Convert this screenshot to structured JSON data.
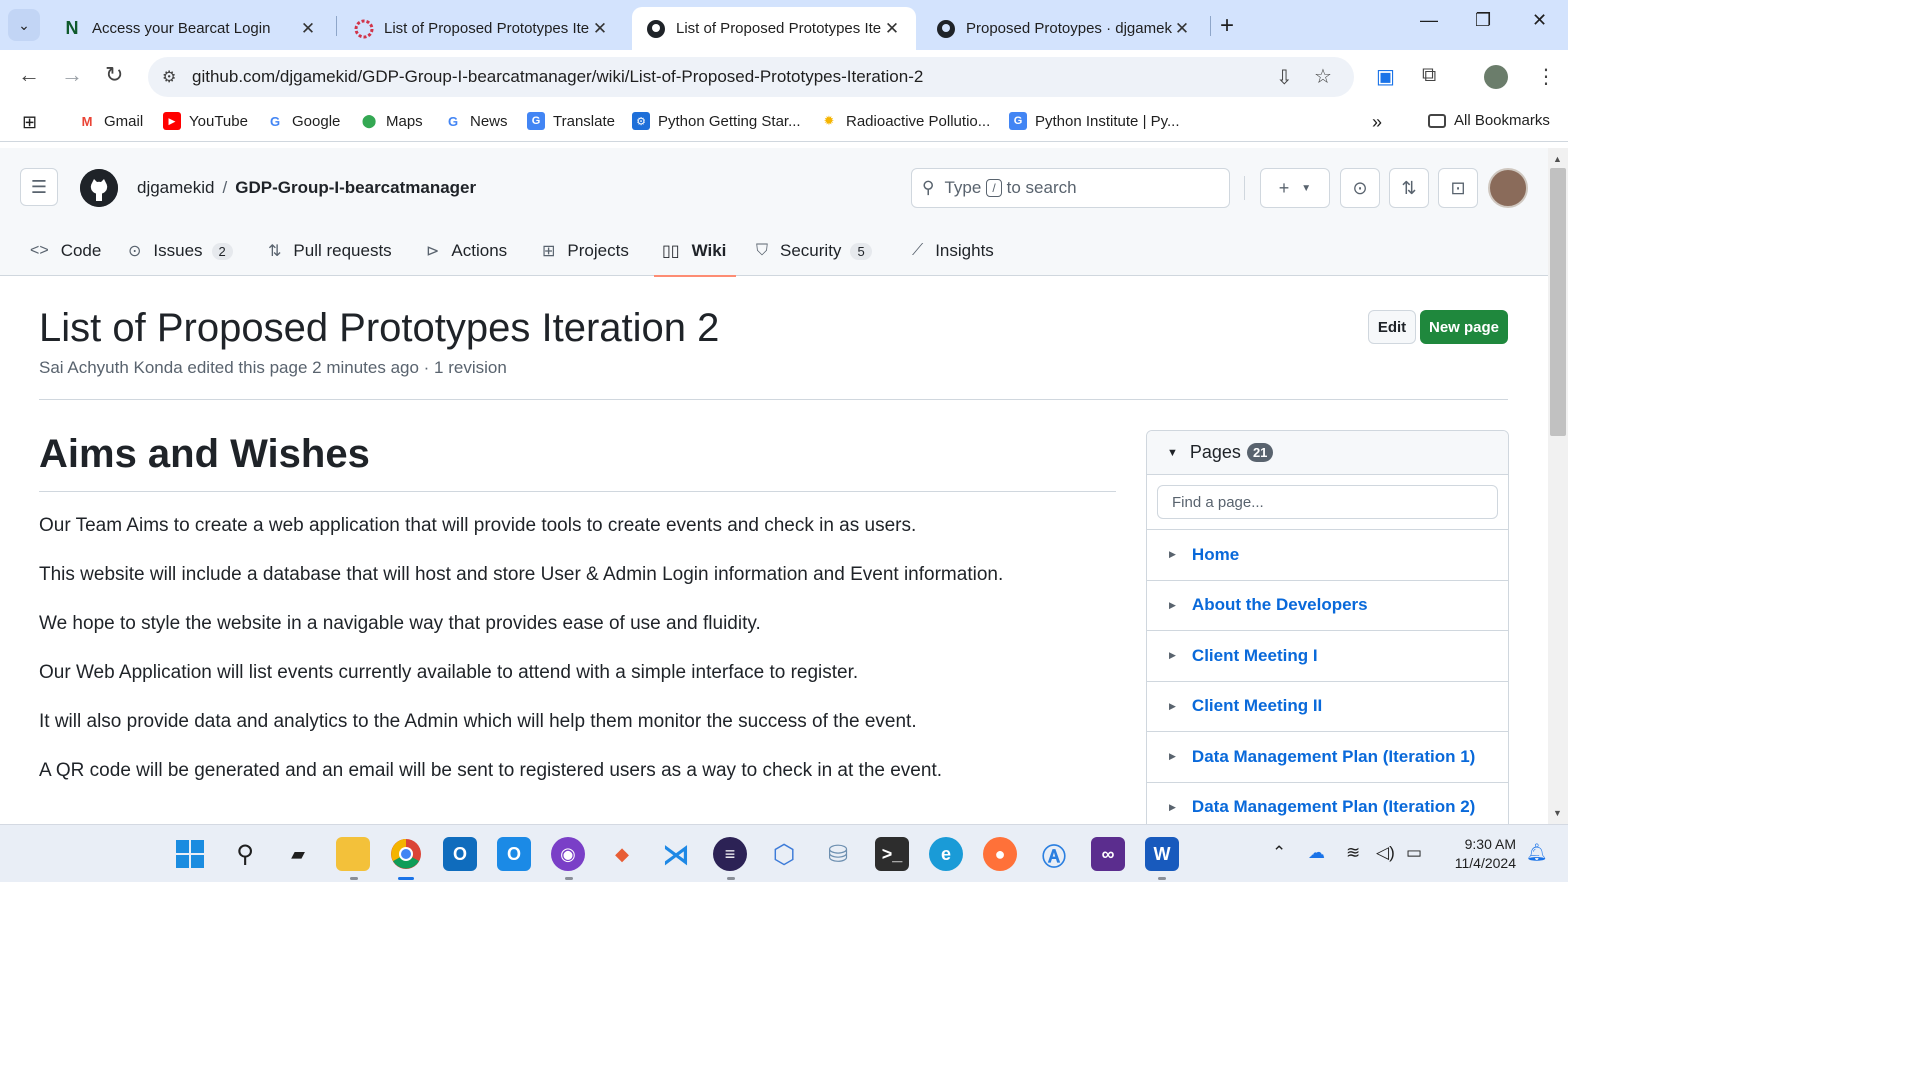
{
  "browser": {
    "tabs": [
      {
        "title": "Access your Bearcat Login",
        "icon": "notion-n-icon",
        "active": false
      },
      {
        "title": "List of Proposed Prototypes Iter",
        "icon": "bearcat-red-icon",
        "active": false
      },
      {
        "title": "List of Proposed Prototypes Iter",
        "icon": "github-icon",
        "active": true
      },
      {
        "title": "Proposed Protoypes · djgameki",
        "icon": "github-icon",
        "active": false
      }
    ],
    "url": "github.com/djgamekid/GDP-Group-I-bearcatmanager/wiki/List-of-Proposed-Prototypes-Iteration-2",
    "bookmarks": [
      {
        "label": "Gmail",
        "icon": "gmail-icon"
      },
      {
        "label": "YouTube",
        "icon": "youtube-icon"
      },
      {
        "label": "Google",
        "icon": "google-icon"
      },
      {
        "label": "Maps",
        "icon": "maps-icon"
      },
      {
        "label": "News",
        "icon": "google-news-icon"
      },
      {
        "label": "Translate",
        "icon": "translate-icon"
      },
      {
        "label": "Python Getting Star...",
        "icon": "pycharm-icon"
      },
      {
        "label": "Radioactive Pollutio...",
        "icon": "sun-icon"
      },
      {
        "label": "Python Institute | Py...",
        "icon": "translate-icon"
      }
    ],
    "all_bookmarks": "All Bookmarks"
  },
  "github": {
    "owner": "djgamekid",
    "repo": "GDP-Group-I-bearcatmanager",
    "search": {
      "prefix": "Type",
      "key": "/",
      "suffix": "to search"
    },
    "nav": [
      {
        "label": "Code",
        "icon": "code-icon",
        "count": ""
      },
      {
        "label": "Issues",
        "icon": "issue-icon",
        "count": "2"
      },
      {
        "label": "Pull requests",
        "icon": "pull-request-icon",
        "count": ""
      },
      {
        "label": "Actions",
        "icon": "play-icon",
        "count": ""
      },
      {
        "label": "Projects",
        "icon": "table-icon",
        "count": ""
      },
      {
        "label": "Wiki",
        "icon": "book-icon",
        "count": ""
      },
      {
        "label": "Security",
        "icon": "shield-icon",
        "count": "5"
      },
      {
        "label": "Insights",
        "icon": "graph-icon",
        "count": ""
      }
    ],
    "selected_nav": "Wiki"
  },
  "wiki": {
    "title": "List of Proposed Prototypes Iteration 2",
    "meta": "Sai Achyuth Konda edited this page 2 minutes ago · 1 revision",
    "edit_label": "Edit",
    "new_page_label": "New page",
    "heading": "Aims and Wishes",
    "paragraphs": [
      "Our Team Aims to create a web application that will provide tools to create events and check in as users.",
      "This website will include a database that will host and store User & Admin Login information and Event information.",
      "We hope to style the website in a navigable way that provides ease of use and fluidity.",
      "Our Web Application will list events currently available to attend with a simple interface to register.",
      "It will also provide data and analytics to the Admin which will help them monitor the success of the event.",
      "A QR code will be generated and an email will be sent to registered users as a way to check in at the event."
    ]
  },
  "sidebar": {
    "title": "Pages",
    "count": "21",
    "find_placeholder": "Find a page...",
    "pages": [
      "Home",
      "About the Developers",
      "Client Meeting I",
      "Client Meeting II",
      "Data Management Plan (Iteration 1)",
      "Data Management Plan (Iteration 2)"
    ]
  },
  "taskbar": {
    "apps": [
      "windows-start-icon",
      "search-icon",
      "task-view-icon",
      "file-explorer-icon",
      "chrome-icon",
      "outlook-icon",
      "outlook-new-icon",
      "github-desktop-icon",
      "git-icon",
      "vscode-icon",
      "eclipse-icon",
      "app-cube-icon",
      "database-icon",
      "terminal-icon",
      "edge-icon",
      "firefox-icon",
      "app-store-icon",
      "app-infinity-icon",
      "word-icon"
    ],
    "time": "9:30 AM",
    "date": "11/4/2024"
  },
  "colors": {
    "accent_green": "#1f883d",
    "link_blue": "#0969da",
    "tab_strip": "#d3e3fd",
    "selected_underline": "#fd8c73"
  }
}
